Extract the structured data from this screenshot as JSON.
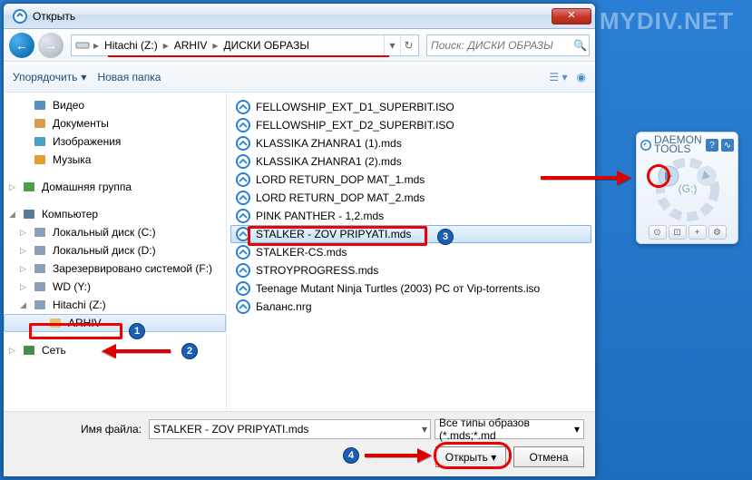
{
  "watermark": "MYDIV.NET",
  "dialog": {
    "title": "Открыть",
    "breadcrumb": [
      "Hitachi (Z:)",
      "ARHIV",
      "ДИСКИ ОБРАЗЫ"
    ],
    "search_placeholder": "Поиск: ДИСКИ ОБРАЗЫ",
    "toolbar": {
      "organize": "Упорядочить",
      "newfolder": "Новая папка"
    },
    "tree_top": [
      {
        "icon": "video",
        "label": "Видео"
      },
      {
        "icon": "doc",
        "label": "Документы"
      },
      {
        "icon": "image",
        "label": "Изображения"
      },
      {
        "icon": "music",
        "label": "Музыка"
      }
    ],
    "tree_homegroup": {
      "label": "Домашняя группа"
    },
    "tree_computer": {
      "label": "Компьютер",
      "drives": [
        {
          "icon": "hdd",
          "label": "Локальный диск (C:)"
        },
        {
          "icon": "hdd",
          "label": "Локальный диск (D:)"
        },
        {
          "icon": "hdd",
          "label": "Зарезервировано системой (F:)"
        },
        {
          "icon": "hdd",
          "label": "WD (Y:)"
        },
        {
          "icon": "hdd",
          "label": "Hitachi (Z:)",
          "hl": true
        },
        {
          "icon": "folder",
          "label": "ARHIV",
          "sel": true,
          "l": 2
        }
      ]
    },
    "tree_network": {
      "label": "Сеть"
    },
    "files": [
      "FELLOWSHIP_EXT_D1_SUPERBIT.ISO",
      "FELLOWSHIP_EXT_D2_SUPERBIT.ISO",
      "KLASSIKA ZHANRA1 (1).mds",
      "KLASSIKA ZHANRA1 (2).mds",
      "LORD RETURN_DOP MAT_1.mds",
      "LORD RETURN_DOP MAT_2.mds",
      "PINK PANTHER - 1,2.mds",
      "STALKER - ZOV PRIPYATI.mds",
      "STALKER-CS.mds",
      "STROYPROGRESS.mds",
      "Teenage Mutant Ninja Turtles (2003) PC от Vip-torrents.iso",
      "Баланс.nrg"
    ],
    "selected_index": 7,
    "filename_label": "Имя файла:",
    "filename_value": "STALKER - ZOV PRIPYATI.mds",
    "filetype": "Все типы образов (*.mds;*.md",
    "open_btn": "Открыть",
    "cancel_btn": "Отмена"
  },
  "gadget": {
    "title1": "DAEMON",
    "title2": "TOOLS",
    "drive": "(G:)"
  }
}
